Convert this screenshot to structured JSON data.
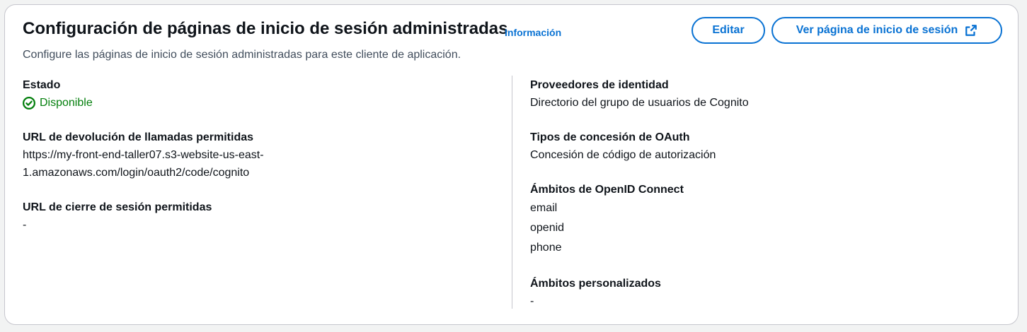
{
  "header": {
    "title": "Configuración de páginas de inicio de sesión administradas",
    "info_link": "Información",
    "description": "Configure las páginas de inicio de sesión administradas para este cliente de aplicación.",
    "edit_button": "Editar",
    "view_button": "Ver página de inicio de sesión"
  },
  "left": {
    "status": {
      "label": "Estado",
      "value": "Disponible",
      "color": "#037f0c",
      "icon": "check-circle-icon"
    },
    "callback_urls": {
      "label": "URL de devolución de llamadas permitidas",
      "line1": "https://my-front-end-taller07.s3-website-us-east-",
      "line2": "1.amazonaws.com/login/oauth2/code/cognito"
    },
    "signout_urls": {
      "label": "URL de cierre de sesión permitidas",
      "value": "-"
    }
  },
  "right": {
    "identity_providers": {
      "label": "Proveedores de identidad",
      "value": "Directorio del grupo de usuarios de Cognito"
    },
    "oauth_grant_types": {
      "label": "Tipos de concesión de OAuth",
      "value": "Concesión de código de autorización"
    },
    "openid_scopes": {
      "label": "Ámbitos de OpenID Connect",
      "items": [
        "email",
        "openid",
        "phone"
      ]
    },
    "custom_scopes": {
      "label": "Ámbitos personalizados",
      "value": "-"
    }
  },
  "colors": {
    "accent": "#0972d3",
    "success": "#037f0c",
    "border": "#c6c6cd"
  }
}
